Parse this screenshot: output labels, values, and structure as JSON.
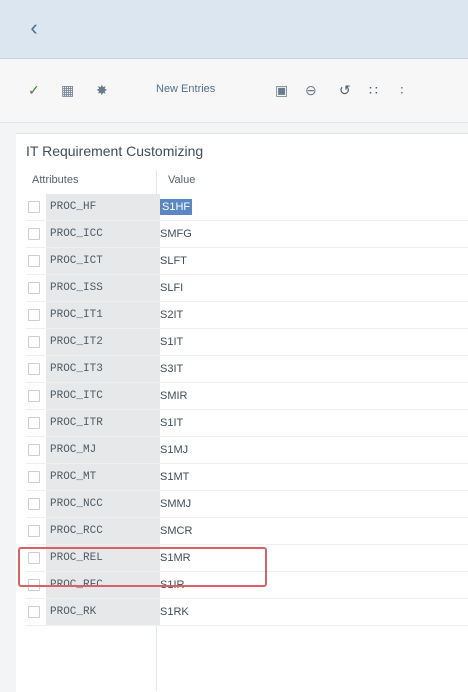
{
  "toolbar": {
    "new_entries_label": "New Entries"
  },
  "panel": {
    "title": "IT Requirement Customizing"
  },
  "table": {
    "headers": {
      "attributes": "Attributes",
      "value": "Value"
    },
    "rows": [
      {
        "attribute": "PROC_HF",
        "value": "S1HF"
      },
      {
        "attribute": "PROC_ICC",
        "value": "SMFG"
      },
      {
        "attribute": "PROC_ICT",
        "value": "SLFT"
      },
      {
        "attribute": "PROC_ISS",
        "value": "SLFI"
      },
      {
        "attribute": "PROC_IT1",
        "value": "S2IT"
      },
      {
        "attribute": "PROC_IT2",
        "value": "S1IT"
      },
      {
        "attribute": "PROC_IT3",
        "value": "S3IT"
      },
      {
        "attribute": "PROC_ITC",
        "value": "SMIR"
      },
      {
        "attribute": "PROC_ITR",
        "value": "S1IT"
      },
      {
        "attribute": "PROC_MJ",
        "value": "S1MJ"
      },
      {
        "attribute": "PROC_MT",
        "value": "S1MT"
      },
      {
        "attribute": "PROC_NCC",
        "value": "SMMJ"
      },
      {
        "attribute": "PROC_RCC",
        "value": "SMCR"
      },
      {
        "attribute": "PROC_REL",
        "value": "S1MR"
      },
      {
        "attribute": "PROC_RFC",
        "value": "S1IR"
      },
      {
        "attribute": "PROC_RK",
        "value": "S1RK"
      }
    ]
  },
  "colors": {
    "header_bg": "#dbe6f1",
    "selection_bg": "#5a86c1",
    "highlight_border": "#d86366"
  }
}
